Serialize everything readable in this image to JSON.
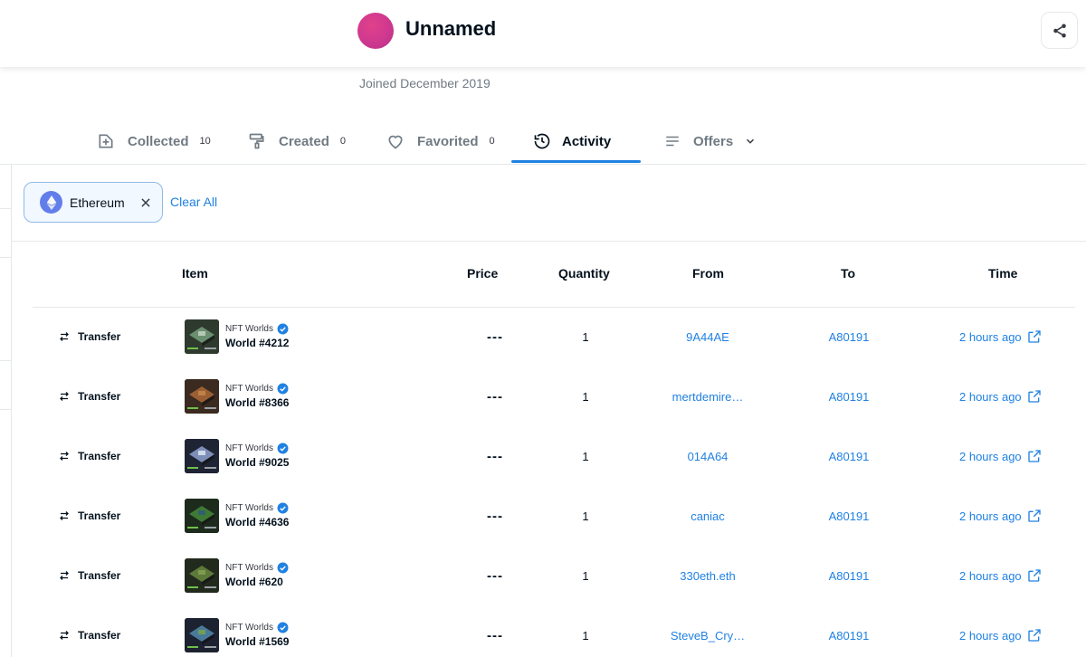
{
  "profile": {
    "name": "Unnamed",
    "joined": "Joined December 2019"
  },
  "colors": {
    "accent": "#2081e2",
    "text": "#04111d",
    "muted": "#707a83",
    "eth": "#627eea",
    "verified": "#2081e2"
  },
  "tabs": [
    {
      "label": "Collected",
      "count": "10",
      "icon": "collected-icon"
    },
    {
      "label": "Created",
      "count": "0",
      "icon": "paint-roller-icon"
    },
    {
      "label": "Favorited",
      "count": "0",
      "icon": "heart-icon"
    },
    {
      "label": "Activity",
      "count": "",
      "icon": "history-icon",
      "active": true
    },
    {
      "label": "Offers",
      "count": "",
      "icon": "list-icon"
    }
  ],
  "filters": {
    "chip_label": "Ethereum",
    "clear_all": "Clear All"
  },
  "table": {
    "headers": [
      "Item",
      "Price",
      "Quantity",
      "From",
      "To",
      "Time"
    ],
    "rows": [
      {
        "event": "Transfer",
        "collection": "NFT Worlds",
        "item": "World #4212",
        "price": "---",
        "quantity": "1",
        "from": "9A44AE",
        "to": "A80191",
        "time": "2 hours ago"
      },
      {
        "event": "Transfer",
        "collection": "NFT Worlds",
        "item": "World #8366",
        "price": "---",
        "quantity": "1",
        "from": "mertdemire…",
        "to": "A80191",
        "time": "2 hours ago"
      },
      {
        "event": "Transfer",
        "collection": "NFT Worlds",
        "item": "World #9025",
        "price": "---",
        "quantity": "1",
        "from": "014A64",
        "to": "A80191",
        "time": "2 hours ago"
      },
      {
        "event": "Transfer",
        "collection": "NFT Worlds",
        "item": "World #4636",
        "price": "---",
        "quantity": "1",
        "from": "caniac",
        "to": "A80191",
        "time": "2 hours ago"
      },
      {
        "event": "Transfer",
        "collection": "NFT Worlds",
        "item": "World #620",
        "price": "---",
        "quantity": "1",
        "from": "330eth.eth",
        "to": "A80191",
        "time": "2 hours ago"
      },
      {
        "event": "Transfer",
        "collection": "NFT Worlds",
        "item": "World #1569",
        "price": "---",
        "quantity": "1",
        "from": "SteveB_Cry…",
        "to": "A80191",
        "time": "2 hours ago"
      }
    ]
  }
}
